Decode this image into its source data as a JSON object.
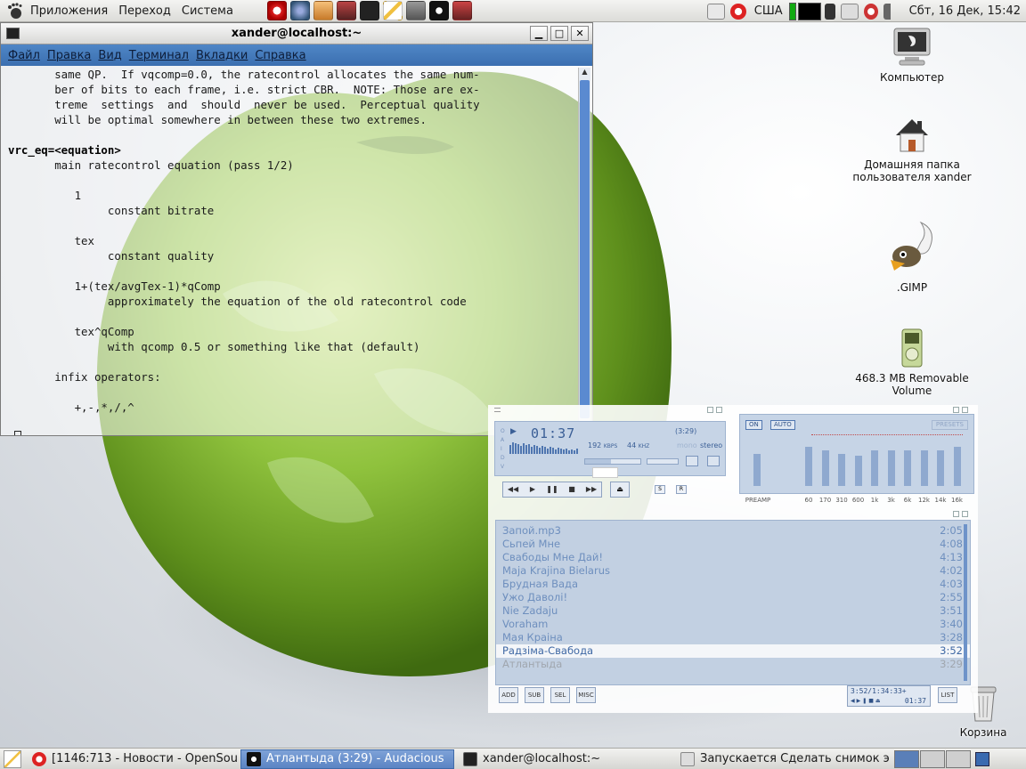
{
  "top_panel": {
    "menus": [
      "Приложения",
      "Переход",
      "Система"
    ],
    "launchers": [
      "opera-icon",
      "browser-icon",
      "people-icon",
      "film-icon",
      "terminal-icon",
      "text-editor-icon",
      "gimp-icon",
      "audacious-icon",
      "film-strip-icon"
    ],
    "tray": {
      "keyboard_layout": "США",
      "clock": "Сбт, 16 Дек, 15:42"
    }
  },
  "terminal": {
    "title": "xander@localhost:~",
    "menu": [
      "Файл",
      "Правка",
      "Вид",
      "Терминал",
      "Вкладки",
      "Справка"
    ],
    "lines": [
      {
        "t": "       same QP.  If vqcomp=0.0, the ratecontrol allocates the same num-",
        "b": false
      },
      {
        "t": "       ber of bits to each frame, i.e. strict CBR.  NOTE: Those are ex-",
        "b": false
      },
      {
        "t": "       treme  settings  and  should  never be used.  Perceptual quality",
        "b": false
      },
      {
        "t": "       will be optimal somewhere in between these two extremes.",
        "b": false
      },
      {
        "t": "",
        "b": false
      },
      {
        "t": "vrc_eq=<equation>",
        "b": true
      },
      {
        "t": "       main ratecontrol equation (pass 1/2)",
        "b": false
      },
      {
        "t": "",
        "b": false
      },
      {
        "t": "          1",
        "b": false
      },
      {
        "t": "               constant bitrate",
        "b": false
      },
      {
        "t": "",
        "b": false
      },
      {
        "t": "          tex",
        "b": false
      },
      {
        "t": "               constant quality",
        "b": false
      },
      {
        "t": "",
        "b": false
      },
      {
        "t": "          1+(tex/avgTex-1)*qComp",
        "b": false
      },
      {
        "t": "               approximately the equation of the old ratecontrol code",
        "b": false
      },
      {
        "t": "",
        "b": false
      },
      {
        "t": "          tex^qComp",
        "b": false
      },
      {
        "t": "               with qcomp 0.5 or something like that (default)",
        "b": false
      },
      {
        "t": "",
        "b": false
      },
      {
        "t": "       infix operators:",
        "b": false
      },
      {
        "t": "",
        "b": false
      },
      {
        "t": "          +,-,*,/,^",
        "b": false
      },
      {
        "t": "",
        "b": false
      }
    ],
    "prompt": ":"
  },
  "desktop": {
    "icons": [
      {
        "name": "computer",
        "label": "Компьютер"
      },
      {
        "name": "home",
        "label": "Домашняя папка пользователя xander"
      },
      {
        "name": "gimp",
        "label": ".GIMP"
      },
      {
        "name": "removable",
        "label": "468.3 MB Removable Volume"
      },
      {
        "name": "trash",
        "label": "Корзина"
      }
    ]
  },
  "audacious": {
    "time": "01:37",
    "length": "(3:29)",
    "kbps": "192",
    "kbps_unit": "KBPS",
    "khz": "44",
    "khz_unit": "KHZ",
    "mono": "mono",
    "stereo": "stereo",
    "seek_fraction": 0.46,
    "eq": {
      "on": "ON",
      "auto": "AUTO",
      "presets": "PRESETS",
      "preamp": "PREAMP",
      "bands": [
        "60",
        "170",
        "310",
        "600",
        "1k",
        "3k",
        "6k",
        "12k",
        "14k",
        "16k"
      ]
    },
    "playlist": [
      {
        "title": "Запой.mp3",
        "time": "2:05"
      },
      {
        "title": "Сьпей Мне",
        "time": "4:08"
      },
      {
        "title": "Свабоды Мне Дай!",
        "time": "4:13"
      },
      {
        "title": "Maja Krajina Bielarus",
        "time": "4:02"
      },
      {
        "title": "Брудная Вада",
        "time": "4:03"
      },
      {
        "title": "Ужо Даволі!",
        "time": "2:55"
      },
      {
        "title": "Nie Zadaju",
        "time": "3:51"
      },
      {
        "title": "Voraham",
        "time": "3:40"
      },
      {
        "title": "Мая Краіна",
        "time": "3:28"
      },
      {
        "title": "Радзіма-Свабода",
        "time": "3:52"
      },
      {
        "title": "Атлантыда",
        "time": "3:29"
      }
    ],
    "current_index": 9,
    "buttons": {
      "add": "ADD",
      "sub": "SUB",
      "sel": "SEL",
      "misc": "MISC",
      "list": "LIST"
    },
    "pl_info": "3:52/1:34:33+",
    "pl_time": "01:37"
  },
  "taskbar": {
    "tasks": [
      {
        "label": "[1146:713 - Новости - OpenSou...",
        "icon": "opera-icon",
        "active": false
      },
      {
        "label": "Атлантыда (3:29) - Audacious",
        "icon": "audacious-icon",
        "active": true
      },
      {
        "label": "xander@localhost:~",
        "icon": "terminal-icon",
        "active": false
      },
      {
        "label": "Запускается Сделать снимок э...",
        "icon": "screenshot-icon",
        "active": false
      }
    ]
  }
}
